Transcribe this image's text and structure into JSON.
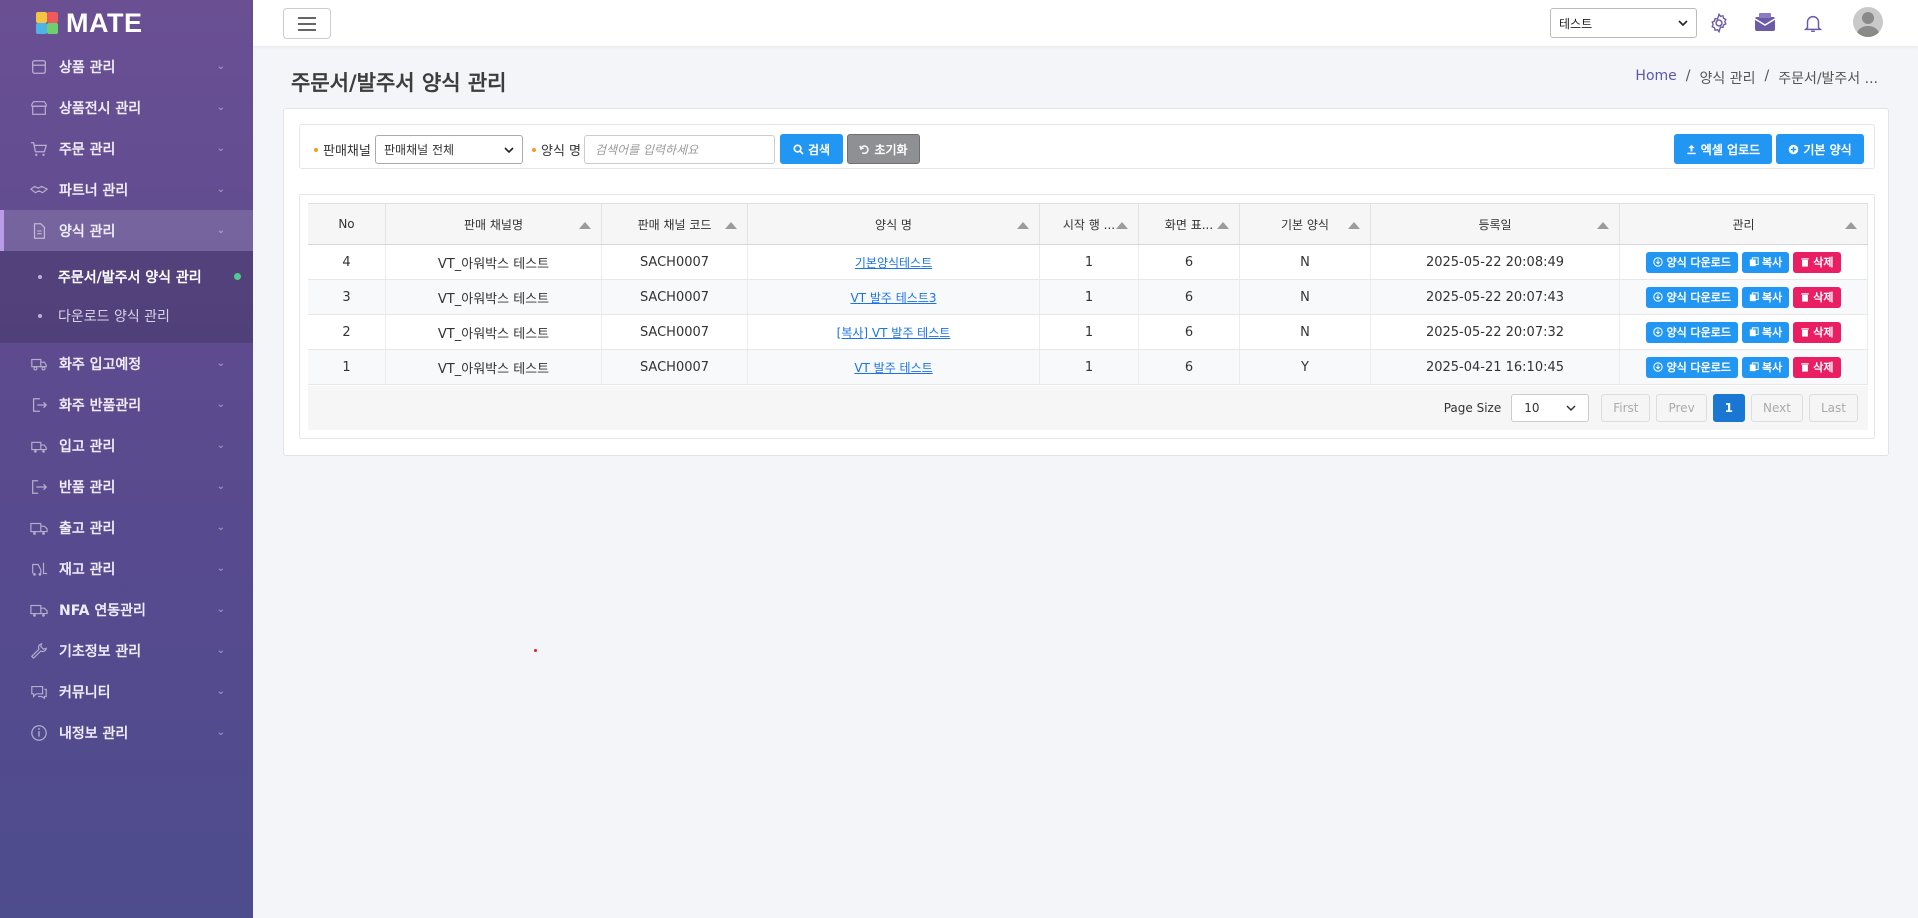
{
  "app": {
    "name": "MATE"
  },
  "sidebar": {
    "items": [
      {
        "label": "상품 관리",
        "icon": "box-icon"
      },
      {
        "label": "상품전시 관리",
        "icon": "store-icon"
      },
      {
        "label": "주문 관리",
        "icon": "cart-icon"
      },
      {
        "label": "파트너 관리",
        "icon": "handshake-icon"
      },
      {
        "label": "양식 관리",
        "icon": "document-icon",
        "active": true
      },
      {
        "label": "화주 입고예정",
        "icon": "truck-in-icon"
      },
      {
        "label": "화주 반품관리",
        "icon": "return-icon"
      },
      {
        "label": "입고 관리",
        "icon": "inbound-icon"
      },
      {
        "label": "반품 관리",
        "icon": "exit-icon"
      },
      {
        "label": "출고 관리",
        "icon": "truck-icon"
      },
      {
        "label": "재고 관리",
        "icon": "forklift-icon"
      },
      {
        "label": "NFA 연동관리",
        "icon": "truck-link-icon"
      },
      {
        "label": "기초정보 관리",
        "icon": "wrench-icon"
      },
      {
        "label": "커뮤니티",
        "icon": "chat-icon"
      },
      {
        "label": "내정보 관리",
        "icon": "info-icon"
      }
    ],
    "submenu": [
      {
        "label": "주문서/발주서 양식 관리",
        "current": true
      },
      {
        "label": "다운로드 양식 관리"
      }
    ]
  },
  "topbar": {
    "select_value": "테스트"
  },
  "page": {
    "title": "주문서/발주서 양식 관리",
    "breadcrumb": [
      "Home",
      "/",
      "양식 관리",
      "/",
      "주문서/발주서 ..."
    ]
  },
  "filter": {
    "channel_label": "판매채널",
    "channel_value": "판매채널 전체",
    "name_label": "양식 명",
    "name_placeholder": "검색어를 입력하세요",
    "search_label": "검색",
    "reset_label": "초기화",
    "excel_upload_label": "엑셀 업로드",
    "default_form_label": "기본 양식"
  },
  "table": {
    "columns": [
      "No",
      "판매 채널명",
      "판매 채널 코드",
      "양식 명",
      "시작 행 ...",
      "화면 표...",
      "기본 양식",
      "등록일",
      "관리"
    ],
    "rows": [
      {
        "no": "4",
        "channel": "VT_아워박스 테스트",
        "code": "SACH0007",
        "name": "기본양식테스트",
        "start": "1",
        "display": "6",
        "default": "N",
        "date": "2025-05-22 20:08:49"
      },
      {
        "no": "3",
        "channel": "VT_아워박스 테스트",
        "code": "SACH0007",
        "name": "VT 발주 테스트3",
        "start": "1",
        "display": "6",
        "default": "N",
        "date": "2025-05-22 20:07:43"
      },
      {
        "no": "2",
        "channel": "VT_아워박스 테스트",
        "code": "SACH0007",
        "name": "[복사] VT 발주 테스트",
        "start": "1",
        "display": "6",
        "default": "N",
        "date": "2025-05-22 20:07:32"
      },
      {
        "no": "1",
        "channel": "VT_아워박스 테스트",
        "code": "SACH0007",
        "name": "VT 발주 테스트",
        "start": "1",
        "display": "6",
        "default": "Y",
        "date": "2025-04-21 16:10:45"
      }
    ],
    "actions": {
      "download": "양식 다운로드",
      "copy": "복사",
      "delete": "삭제"
    }
  },
  "pager": {
    "page_size_label": "Page Size",
    "page_size": "10",
    "first": "First",
    "prev": "Prev",
    "current": "1",
    "next": "Next",
    "last": "Last"
  }
}
